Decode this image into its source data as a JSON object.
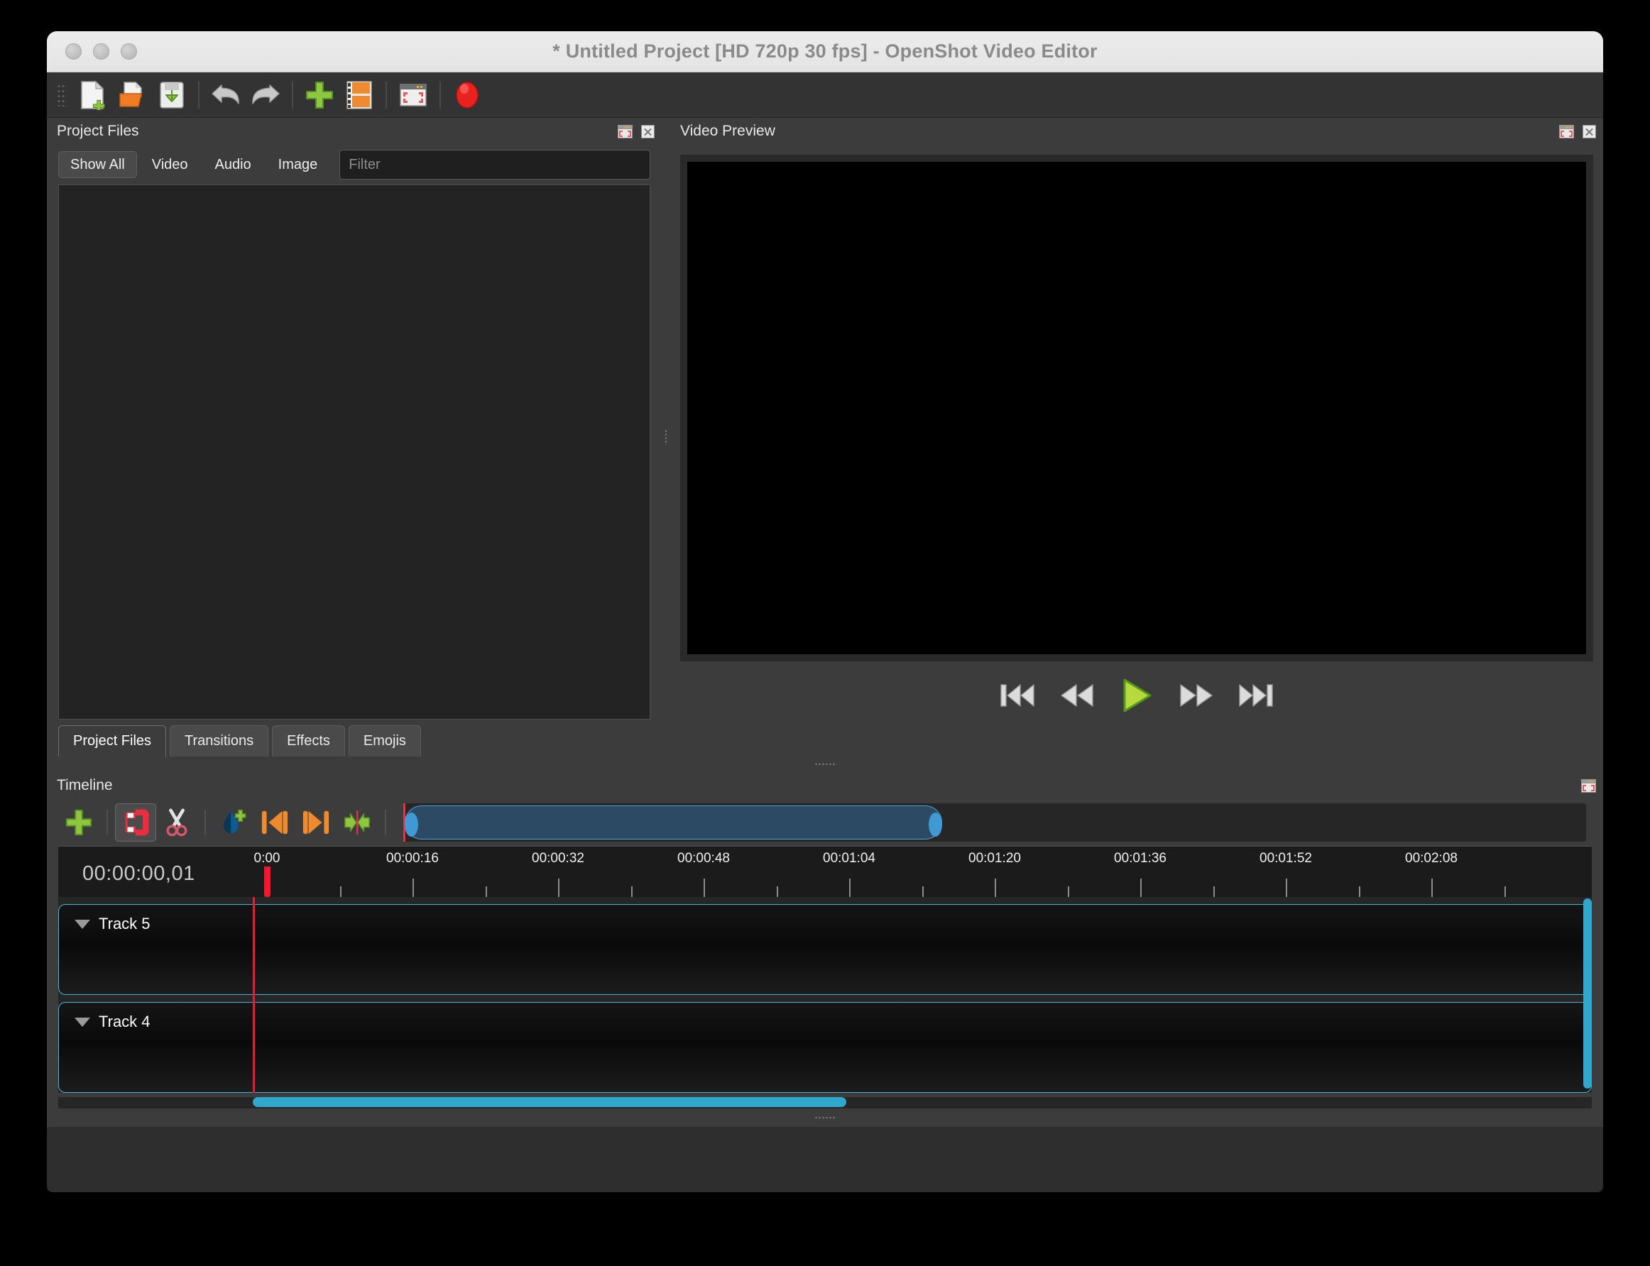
{
  "window": {
    "title": "* Untitled Project [HD 720p 30 fps] - OpenShot Video Editor",
    "traffic_lights": [
      "close-button",
      "minimize-button",
      "zoom-button"
    ]
  },
  "main_toolbar": {
    "items": [
      {
        "name": "new-project-button",
        "icon": "new-file-icon",
        "label": "New Project"
      },
      {
        "name": "open-project-button",
        "icon": "open-folder-icon",
        "label": "Open Project"
      },
      {
        "name": "save-project-button",
        "icon": "save-disk-icon",
        "label": "Save Project"
      },
      {
        "name": "undo-button",
        "icon": "undo-arrow-icon",
        "label": "Undo"
      },
      {
        "name": "redo-button",
        "icon": "redo-arrow-icon",
        "label": "Redo"
      },
      {
        "name": "import-files-button",
        "icon": "green-plus-icon",
        "label": "Import Files"
      },
      {
        "name": "choose-profile-button",
        "icon": "film-strip-icon",
        "label": "Choose Profile"
      },
      {
        "name": "fullscreen-button",
        "icon": "fullscreen-icon",
        "label": "Full Screen"
      },
      {
        "name": "export-video-button",
        "icon": "red-record-icon",
        "label": "Export Video"
      }
    ]
  },
  "project_files": {
    "header": "Project Files",
    "float_label": "Undock",
    "close_label": "Close",
    "filters": [
      {
        "label": "Show All",
        "active": true
      },
      {
        "label": "Video",
        "active": false
      },
      {
        "label": "Audio",
        "active": false
      },
      {
        "label": "Image",
        "active": false
      }
    ],
    "filter_placeholder": "Filter",
    "filter_value": "",
    "files": []
  },
  "tabs": [
    {
      "label": "Project Files",
      "active": true
    },
    {
      "label": "Transitions",
      "active": false
    },
    {
      "label": "Effects",
      "active": false
    },
    {
      "label": "Emojis",
      "active": false
    }
  ],
  "video_preview": {
    "header": "Video Preview",
    "float_label": "Undock",
    "close_label": "Close",
    "transport": [
      {
        "name": "jump-to-start-button",
        "icon": "skip-backward-icon",
        "label": "Jump To Start"
      },
      {
        "name": "rewind-button",
        "icon": "rewind-icon",
        "label": "Rewind"
      },
      {
        "name": "play-button",
        "icon": "play-icon",
        "label": "Play"
      },
      {
        "name": "fast-forward-button",
        "icon": "fast-forward-icon",
        "label": "Fast Forward"
      },
      {
        "name": "jump-to-end-button",
        "icon": "skip-forward-icon",
        "label": "Jump To End"
      }
    ]
  },
  "timeline": {
    "header": "Timeline",
    "float_label": "Undock",
    "toolbar": [
      {
        "name": "add-track-button",
        "icon": "green-plus-icon",
        "label": "Add Track",
        "toggled": false
      },
      {
        "name": "snapping-toggle",
        "icon": "magnet-icon",
        "label": "Enable Snapping",
        "toggled": true
      },
      {
        "name": "razor-tool-button",
        "icon": "scissors-icon",
        "label": "Razor Tool",
        "toggled": false
      },
      {
        "name": "add-marker-button",
        "icon": "water-drop-plus-icon",
        "label": "Add Marker",
        "toggled": false
      },
      {
        "name": "previous-marker-button",
        "icon": "previous-marker-icon",
        "label": "Previous Marker",
        "toggled": false
      },
      {
        "name": "next-marker-button",
        "icon": "next-marker-icon",
        "label": "Next Marker",
        "toggled": false
      },
      {
        "name": "center-playhead-button",
        "icon": "center-playhead-icon",
        "label": "Center the Playhead",
        "toggled": false
      }
    ],
    "timecode": "00:00:00,01",
    "ruler_labels": [
      "0:00",
      "00:00:16",
      "00:00:32",
      "00:00:48",
      "00:01:04",
      "00:01:20",
      "00:01:36",
      "00:01:52",
      "00:02:08"
    ],
    "tracks": [
      {
        "name": "Track 5"
      },
      {
        "name": "Track 4"
      }
    ]
  },
  "colors": {
    "window_chrome": "#ececec",
    "panel_bg": "#3c3c3c",
    "dark_bg": "#232323",
    "accent_cyan": "#3ab9dd",
    "playhead_red": "#f5172f",
    "play_green": "#8cc63f",
    "zoom_blue": "#3f9ad4"
  }
}
